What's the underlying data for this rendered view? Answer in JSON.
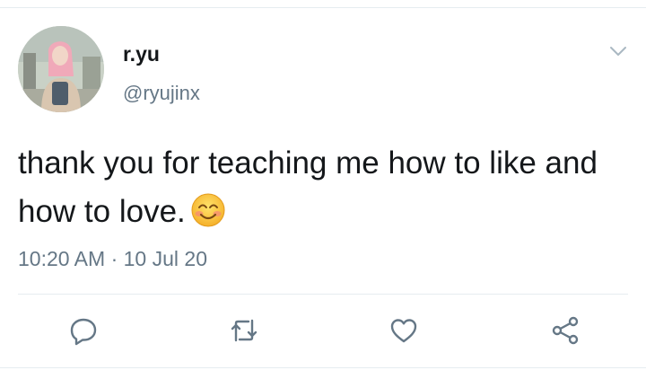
{
  "tweet": {
    "display_name": "r.yu",
    "handle": "@ryujinx",
    "text": "thank you for teaching me how to like and how to love.",
    "emoji": "smiling-face-with-smiling-eyes",
    "time": "10:20 AM",
    "separator": "·",
    "date": "10 Jul 20"
  },
  "icons": {
    "caret": "chevron-down-icon",
    "reply": "reply-icon",
    "retweet": "retweet-icon",
    "like": "heart-icon",
    "share": "share-icon"
  },
  "colors": {
    "text_primary": "#14171a",
    "text_secondary": "#657786",
    "icon": "#657786",
    "divider": "#e6ecf0"
  }
}
